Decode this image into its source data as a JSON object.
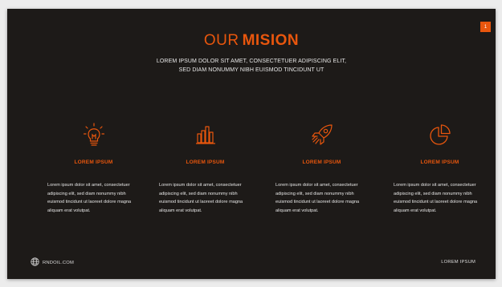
{
  "slide": {
    "page_number": "1",
    "title_light": "OUR",
    "title_bold": "MISION",
    "subtitle_line1": "LOREM IPSUM DOLOR SIT AMET, CONSECTETUER ADIPISCING ELIT,",
    "subtitle_line2": "SED DIAM NONUMMY NIBH EUISMOD TINCIDUNT UT"
  },
  "features": [
    {
      "icon": "lightbulb-icon",
      "heading": "LOREM IPSUM",
      "body": "Lorem ipsum dolor sit amet, consectetuer adipiscing elit, sed diam nonummy nibh euismod tincidunt ut laoreet dolore magna aliquam erat volutpat."
    },
    {
      "icon": "bar-chart-icon",
      "heading": "LOREM IPSUM",
      "body": "Lorem ipsum dolor sit amet, consectetuer adipiscing elit, sed diam nonummy nibh euismod tincidunt ut laoreet dolore magna aliquam erat volutpat."
    },
    {
      "icon": "rocket-icon",
      "heading": "LOREM IPSUM",
      "body": "Lorem ipsum dolor sit amet, consectetuer adipiscing elit, sed diam nonummy nibh euismod tincidunt ut laoreet dolore magna aliquam erat volutpat."
    },
    {
      "icon": "pie-chart-icon",
      "heading": "LOREM IPSUM",
      "body": "Lorem ipsum dolor sit amet, consectetuer adipiscing elit, sed diam nonummy nibh euismod tincidunt ut laoreet dolore magna aliquam erat volutpat."
    }
  ],
  "footer": {
    "website": "RNDOIL.COM",
    "website_icon": "globe-icon",
    "right_text": "LOREM IPSUM"
  },
  "colors": {
    "accent": "#e8560d",
    "background": "#1d1a18",
    "text": "#f2f2f2"
  }
}
